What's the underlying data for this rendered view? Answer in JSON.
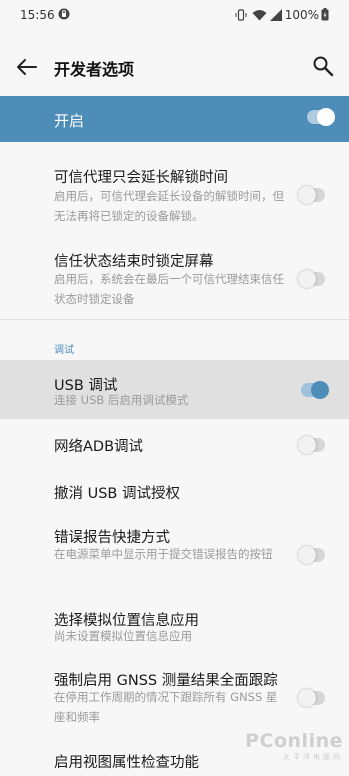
{
  "status": {
    "time": "15:56",
    "battery": "100%",
    "icons": [
      "vpn-icon",
      "vibrate-icon",
      "wifi-icon",
      "signal-icon",
      "battery-icon"
    ]
  },
  "appbar": {
    "title": "开发者选项",
    "back_icon": "arrow-left-icon",
    "search_icon": "search-icon"
  },
  "master": {
    "label": "开启",
    "enabled": true
  },
  "items": [
    {
      "title": "可信代理只会延长解锁时间",
      "summary": "启用后，可信代理会延长设备的解锁时间，但无法再将已锁定的设备解锁。",
      "checked": false
    },
    {
      "title": "信任状态结束时锁定屏幕",
      "summary": "启用后，系统会在最后一个可信代理结束信任状态时锁定设备",
      "checked": false
    }
  ],
  "debug_section": {
    "header": "调试",
    "items": [
      {
        "title": "USB 调试",
        "summary": "连接 USB 后启用调试模式",
        "checked": true
      },
      {
        "title": "网络ADB调试",
        "checked": false
      },
      {
        "title": "撤消 USB 调试授权"
      },
      {
        "title": "错误报告快捷方式",
        "summary": "在电源菜单中显示用于提交错误报告的按钮",
        "checked": false
      },
      {
        "title": "选择模拟位置信息应用",
        "summary": "尚未设置模拟位置信息应用"
      },
      {
        "title": "强制启用 GNSS 测量结果全面跟踪",
        "summary": "在停用工作周期的情况下跟踪所有 GNSS 星座和频率",
        "checked": false
      },
      {
        "title": "启用视图属性检查功能"
      }
    ]
  },
  "watermark": {
    "brand": "PConline",
    "sub": "太平洋电脑网"
  },
  "colors": {
    "accent": "#4d8db8",
    "background": "#f7f7f7",
    "highlight": "#e0e0e0"
  }
}
